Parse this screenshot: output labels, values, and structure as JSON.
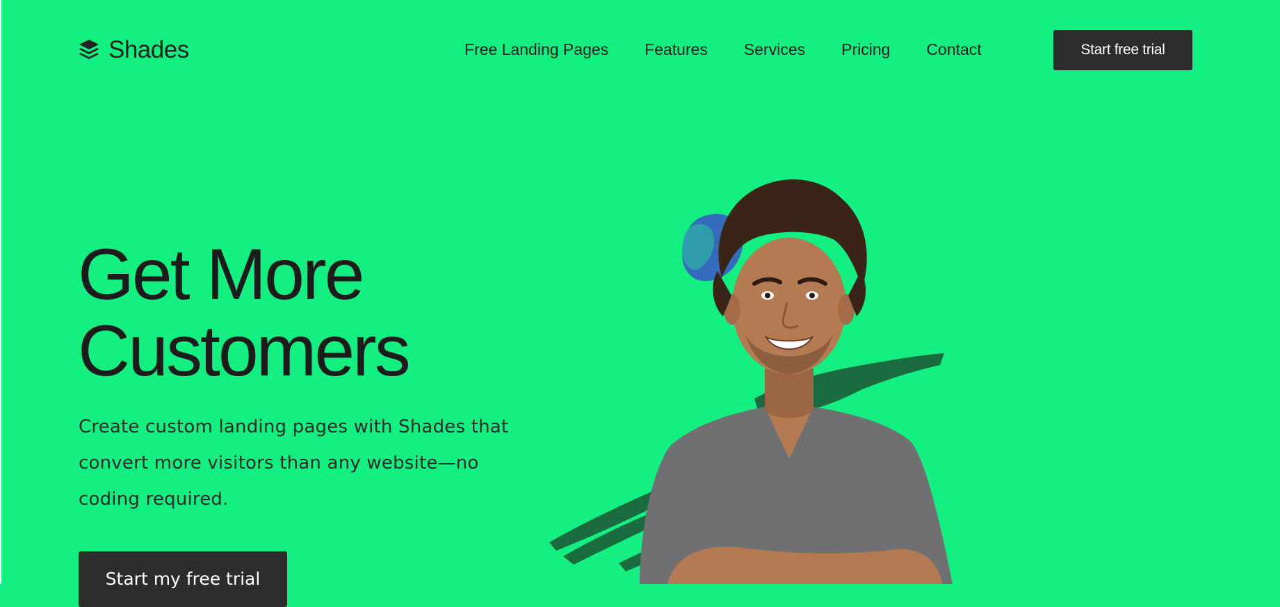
{
  "brand": {
    "name": "Shades",
    "logo_icon": "layers-icon"
  },
  "nav": {
    "items": [
      {
        "label": "Free Landing Pages"
      },
      {
        "label": "Features"
      },
      {
        "label": "Services"
      },
      {
        "label": "Pricing"
      },
      {
        "label": "Contact"
      }
    ]
  },
  "header": {
    "cta_label": "Start free trial"
  },
  "hero": {
    "title_line1": "Get More",
    "title_line2": "Customers",
    "subtitle": "Create custom landing pages with Shades that convert more visitors than any website—no coding required.",
    "cta_label": "Start my free trial"
  },
  "colors": {
    "background": "#13f081",
    "button": "#2c2c2c",
    "text": "#1f1f1f",
    "brush_stroke": "#1a6b3f",
    "paint_blob": "#3b54c4"
  }
}
